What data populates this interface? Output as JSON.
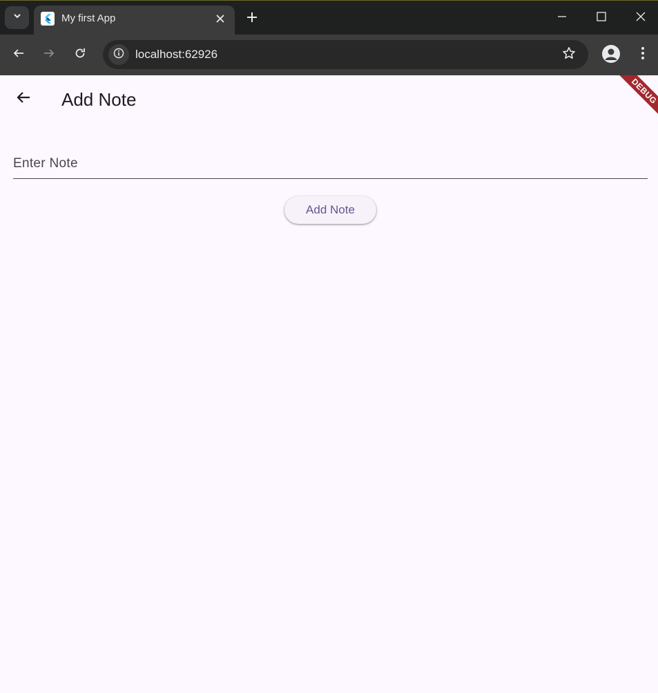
{
  "browser": {
    "tab": {
      "title": "My first App"
    },
    "omnibox": {
      "url": "localhost:62926"
    }
  },
  "app": {
    "appbar": {
      "title": "Add Note"
    },
    "note_input": {
      "placeholder": "Enter Note",
      "value": ""
    },
    "add_button": {
      "label": "Add Note"
    },
    "debug_banner": {
      "label": "DEBUG"
    }
  },
  "colors": {
    "app_background": "#fdf7ff",
    "button_text": "#65558f",
    "debug_banner": "#a3282d",
    "browser_frame": "#3c3c3c"
  },
  "icons": {
    "tab_favicon": "flutter-logo-icon",
    "tab_search": "chevron-down-icon",
    "tab_close": "close-icon",
    "new_tab": "plus-icon",
    "back": "arrow-left-icon",
    "forward": "arrow-right-icon",
    "reload": "reload-icon",
    "site_info": "info-icon",
    "bookmark": "star-icon",
    "profile": "person-icon",
    "menu": "kebab-menu-icon",
    "minimize": "minimize-icon",
    "maximize": "maximize-icon",
    "close_window": "close-window-icon"
  }
}
